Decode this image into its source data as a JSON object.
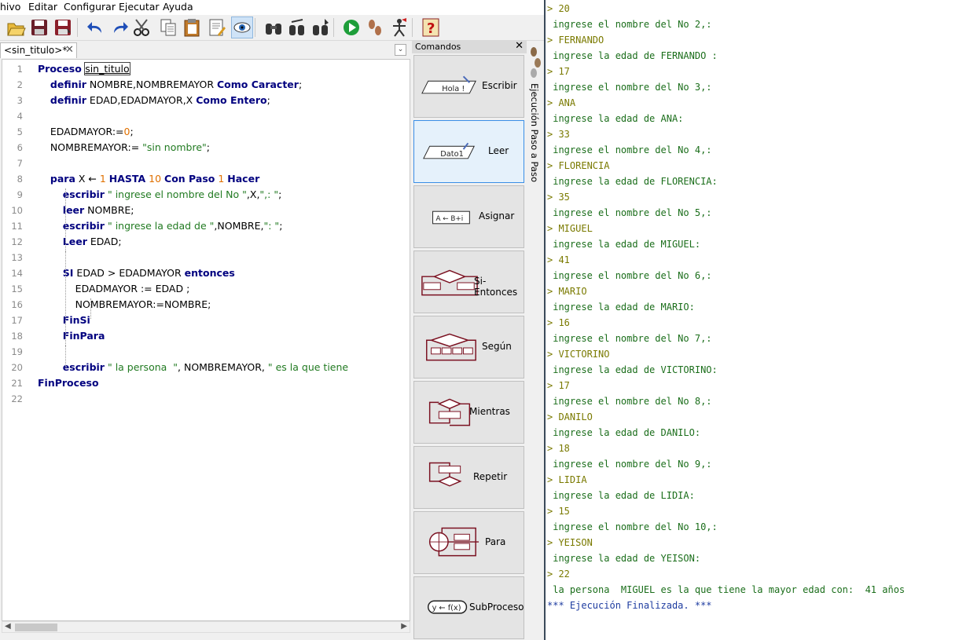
{
  "menu": [
    "hivo",
    "Editar",
    "Configurar",
    "Ejecutar",
    "Ayuda"
  ],
  "toolbar": {
    "buttons": [
      "open-icon",
      "save-icon",
      "save-as-icon",
      "undo-icon",
      "redo-icon",
      "cut-icon",
      "copy-icon",
      "paste-icon",
      "edit-icon",
      "watch-icon",
      "find-icon",
      "find-next-icon",
      "replace-icon",
      "run-icon",
      "step-icon",
      "debug-icon",
      "help-icon"
    ],
    "active": "watch-icon"
  },
  "editor": {
    "tab_label": "<sin_titulo>*",
    "tab_close": "✕",
    "dropdown_glyph": "⌄",
    "lines": [
      {
        "n": "1",
        "parts": [
          {
            "t": "Proceso ",
            "c": "kw"
          },
          {
            "t": "sin_titulo",
            "c": "box"
          }
        ]
      },
      {
        "n": "2",
        "parts": [
          {
            "t": "    "
          },
          {
            "t": "definir",
            "c": "kw"
          },
          {
            "t": " NOMBRE,NOMBREMAYOR "
          },
          {
            "t": "Como Caracter",
            "c": "kw"
          },
          {
            "t": ";"
          }
        ]
      },
      {
        "n": "3",
        "parts": [
          {
            "t": "    "
          },
          {
            "t": "definir",
            "c": "kw"
          },
          {
            "t": " EDAD,EDADMAYOR,X "
          },
          {
            "t": "Como Entero",
            "c": "kw"
          },
          {
            "t": ";"
          }
        ]
      },
      {
        "n": "4",
        "parts": []
      },
      {
        "n": "5",
        "parts": [
          {
            "t": "    EDADMAYOR:="
          },
          {
            "t": "0",
            "c": "num"
          },
          {
            "t": ";"
          }
        ]
      },
      {
        "n": "6",
        "parts": [
          {
            "t": "    NOMBREMAYOR:= "
          },
          {
            "t": "\"sin nombre\"",
            "c": "str"
          },
          {
            "t": ";"
          }
        ]
      },
      {
        "n": "7",
        "parts": []
      },
      {
        "n": "8",
        "parts": [
          {
            "t": "    "
          },
          {
            "t": "para",
            "c": "kw"
          },
          {
            "t": " X ← "
          },
          {
            "t": "1",
            "c": "num"
          },
          {
            "t": " "
          },
          {
            "t": "HASTA",
            "c": "kw"
          },
          {
            "t": " "
          },
          {
            "t": "10",
            "c": "num"
          },
          {
            "t": " "
          },
          {
            "t": "Con Paso",
            "c": "kw"
          },
          {
            "t": " "
          },
          {
            "t": "1",
            "c": "num"
          },
          {
            "t": " "
          },
          {
            "t": "Hacer",
            "c": "kw"
          }
        ]
      },
      {
        "n": "9",
        "parts": [
          {
            "t": "        "
          },
          {
            "t": "escribir",
            "c": "kw"
          },
          {
            "t": " "
          },
          {
            "t": "\" ingrese el nombre del No \"",
            "c": "str"
          },
          {
            "t": ",X,"
          },
          {
            "t": "\",: \"",
            "c": "str"
          },
          {
            "t": ";"
          }
        ]
      },
      {
        "n": "10",
        "parts": [
          {
            "t": "        "
          },
          {
            "t": "leer",
            "c": "kw"
          },
          {
            "t": " NOMBRE;"
          }
        ]
      },
      {
        "n": "11",
        "parts": [
          {
            "t": "        "
          },
          {
            "t": "escribir",
            "c": "kw"
          },
          {
            "t": " "
          },
          {
            "t": "\" ingrese la edad de \"",
            "c": "str"
          },
          {
            "t": ",NOMBRE,"
          },
          {
            "t": "\": \"",
            "c": "str"
          },
          {
            "t": ";"
          }
        ]
      },
      {
        "n": "12",
        "parts": [
          {
            "t": "        "
          },
          {
            "t": "Leer",
            "c": "kw"
          },
          {
            "t": " EDAD;"
          }
        ]
      },
      {
        "n": "13",
        "parts": []
      },
      {
        "n": "14",
        "parts": [
          {
            "t": "        "
          },
          {
            "t": "SI",
            "c": "kw"
          },
          {
            "t": " EDAD > EDADMAYOR "
          },
          {
            "t": "entonces",
            "c": "kw"
          }
        ]
      },
      {
        "n": "15",
        "parts": [
          {
            "t": "            EDADMAYOR := EDAD ;"
          }
        ]
      },
      {
        "n": "16",
        "parts": [
          {
            "t": "            NOMBREMAYOR:=NOMBRE;"
          }
        ]
      },
      {
        "n": "17",
        "parts": [
          {
            "t": "        "
          },
          {
            "t": "FinSi",
            "c": "kw"
          }
        ]
      },
      {
        "n": "18",
        "parts": [
          {
            "t": "        "
          },
          {
            "t": "FinPara",
            "c": "kw"
          }
        ]
      },
      {
        "n": "19",
        "parts": []
      },
      {
        "n": "20",
        "parts": [
          {
            "t": "        "
          },
          {
            "t": "escribir",
            "c": "kw"
          },
          {
            "t": " "
          },
          {
            "t": "\" la persona  \"",
            "c": "str"
          },
          {
            "t": ", NOMBREMAYOR, "
          },
          {
            "t": "\" es la que tiene",
            "c": "str"
          }
        ]
      },
      {
        "n": "21",
        "parts": [
          {
            "t": "FinProceso",
            "c": "kw"
          }
        ]
      },
      {
        "n": "22",
        "parts": []
      }
    ]
  },
  "commands": {
    "title": "Comandos",
    "close": "✕",
    "items": [
      {
        "label": "Escribir",
        "icon": "escribir-icon",
        "glyph": "Hola !"
      },
      {
        "label": "Leer",
        "icon": "leer-icon",
        "glyph": "Dato1"
      },
      {
        "label": "Asignar",
        "icon": "asignar-icon",
        "glyph": "A ← B+i"
      },
      {
        "label": "Si-Entonces",
        "icon": "si-entonces-icon",
        "glyph": ""
      },
      {
        "label": "Según",
        "icon": "segun-icon",
        "glyph": ""
      },
      {
        "label": "Mientras",
        "icon": "mientras-icon",
        "glyph": ""
      },
      {
        "label": "Repetir",
        "icon": "repetir-icon",
        "glyph": ""
      },
      {
        "label": "Para",
        "icon": "para-icon",
        "glyph": ""
      },
      {
        "label": "SubProceso",
        "icon": "subproceso-icon",
        "glyph": "y ← f(x)"
      }
    ],
    "selected": 1
  },
  "side_panel": {
    "label": "Ejecución Paso a Paso"
  },
  "console": {
    "lines": [
      {
        "t": "> 20",
        "k": "input"
      },
      {
        "t": " ingrese el nombre del No 2,:",
        "k": "output"
      },
      {
        "t": "> FERNANDO",
        "k": "input"
      },
      {
        "t": " ingrese la edad de FERNANDO :",
        "k": "output"
      },
      {
        "t": "> 17",
        "k": "input"
      },
      {
        "t": " ingrese el nombre del No 3,:",
        "k": "output"
      },
      {
        "t": "> ANA",
        "k": "input"
      },
      {
        "t": " ingrese la edad de ANA:",
        "k": "output"
      },
      {
        "t": "> 33",
        "k": "input"
      },
      {
        "t": " ingrese el nombre del No 4,:",
        "k": "output"
      },
      {
        "t": "> FLORENCIA",
        "k": "input"
      },
      {
        "t": " ingrese la edad de FLORENCIA:",
        "k": "output"
      },
      {
        "t": "> 35",
        "k": "input"
      },
      {
        "t": " ingrese el nombre del No 5,:",
        "k": "output"
      },
      {
        "t": "> MIGUEL",
        "k": "input"
      },
      {
        "t": " ingrese la edad de MIGUEL:",
        "k": "output"
      },
      {
        "t": "> 41",
        "k": "input"
      },
      {
        "t": " ingrese el nombre del No 6,:",
        "k": "output"
      },
      {
        "t": "> MARIO",
        "k": "input"
      },
      {
        "t": " ingrese la edad de MARIO:",
        "k": "output"
      },
      {
        "t": "> 16",
        "k": "input"
      },
      {
        "t": " ingrese el nombre del No 7,:",
        "k": "output"
      },
      {
        "t": "> VICTORINO",
        "k": "input"
      },
      {
        "t": " ingrese la edad de VICTORINO:",
        "k": "output"
      },
      {
        "t": "> 17",
        "k": "input"
      },
      {
        "t": " ingrese el nombre del No 8,:",
        "k": "output"
      },
      {
        "t": "> DANILO",
        "k": "input"
      },
      {
        "t": " ingrese la edad de DANILO:",
        "k": "output"
      },
      {
        "t": "> 18",
        "k": "input"
      },
      {
        "t": " ingrese el nombre del No 9,:",
        "k": "output"
      },
      {
        "t": "> LIDIA",
        "k": "input"
      },
      {
        "t": " ingrese la edad de LIDIA:",
        "k": "output"
      },
      {
        "t": "> 15",
        "k": "input"
      },
      {
        "t": " ingrese el nombre del No 10,:",
        "k": "output"
      },
      {
        "t": "> YEISON",
        "k": "input"
      },
      {
        "t": " ingrese la edad de YEISON:",
        "k": "output"
      },
      {
        "t": "> 22",
        "k": "input"
      },
      {
        "t": " la persona  MIGUEL es la que tiene la mayor edad con:  41 años",
        "k": "output"
      },
      {
        "t": "*** Ejecución Finalizada. ***",
        "k": "system"
      }
    ]
  },
  "colors": {
    "keyword": "#00007f",
    "number": "#e07000",
    "string": "#217a21",
    "console_output": "#1b6e1b",
    "console_input": "#7a7a00",
    "console_system": "#1e3ca0",
    "selection": "#3a8ee6"
  }
}
